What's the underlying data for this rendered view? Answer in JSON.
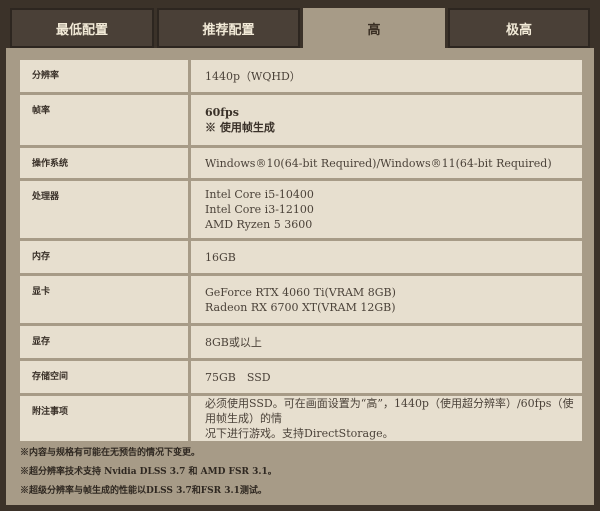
{
  "tabs": [
    {
      "label": "最低配置",
      "active": false
    },
    {
      "label": "推荐配置",
      "active": false
    },
    {
      "label": "高",
      "active": true
    },
    {
      "label": "极高",
      "active": false
    }
  ],
  "rows": [
    {
      "label": "分辨率",
      "lines": [
        "1440p（WQHD）"
      ]
    },
    {
      "label": "帧率",
      "lines": [
        "60fps",
        "※ 使用帧生成"
      ]
    },
    {
      "label": "操作系统",
      "lines": [
        "Windows®10(64-bit Required)/Windows®11(64-bit Required)"
      ]
    },
    {
      "label": "处理器",
      "lines": [
        "Intel Core i5-10400",
        "Intel Core i3-12100",
        "AMD Ryzen 5 3600"
      ]
    },
    {
      "label": "内存",
      "lines": [
        "16GB"
      ]
    },
    {
      "label": "显卡",
      "lines": [
        "GeForce RTX 4060 Ti(VRAM 8GB)",
        "Radeon RX 6700 XT(VRAM 12GB)"
      ]
    },
    {
      "label": "显存",
      "lines": [
        "8GB或以上"
      ]
    },
    {
      "label": "存储空间",
      "lines": [
        "75GB　SSD"
      ]
    },
    {
      "label": "附注事项",
      "lines": [
        "必须使用SSD。可在画面设置为“高”，1440p（使用超分辨率）/60fps（使用帧生成）的情",
        "况下进行游戏。支持DirectStorage。"
      ]
    }
  ],
  "notes": [
    "※内容与规格有可能在无预告的情况下变更。",
    "※超分辨率技术支持 Nvidia DLSS 3.7 和 AMD FSR 3.1。",
    "※超级分辨率与帧生成的性能以DLSS 3.7和FSR 3.1测试。"
  ]
}
